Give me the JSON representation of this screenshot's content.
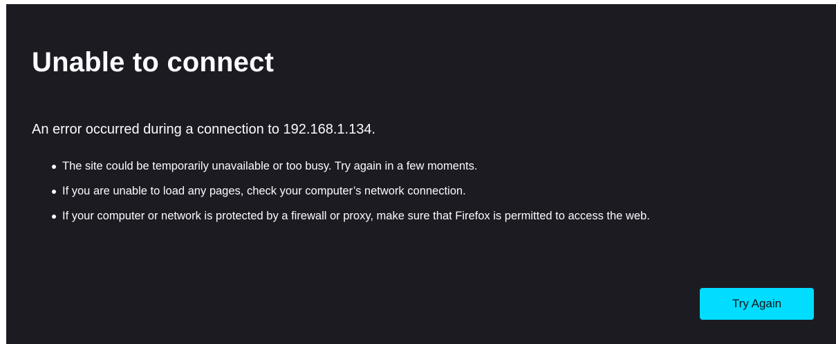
{
  "error": {
    "title": "Unable to connect",
    "intro": "An error occurred during a connection to 192.168.1.134.",
    "suggestions": [
      "The site could be temporarily unavailable or too busy. Try again in a few moments.",
      "If you are unable to load any pages, check your computer’s network connection.",
      "If your computer or network is protected by a firewall or proxy, make sure that Firefox is permitted to access the web."
    ],
    "button_label": "Try Again"
  },
  "colors": {
    "background": "#1c1b22",
    "text": "#fbfbfe",
    "accent": "#00ddff",
    "button_text": "#15141a"
  }
}
